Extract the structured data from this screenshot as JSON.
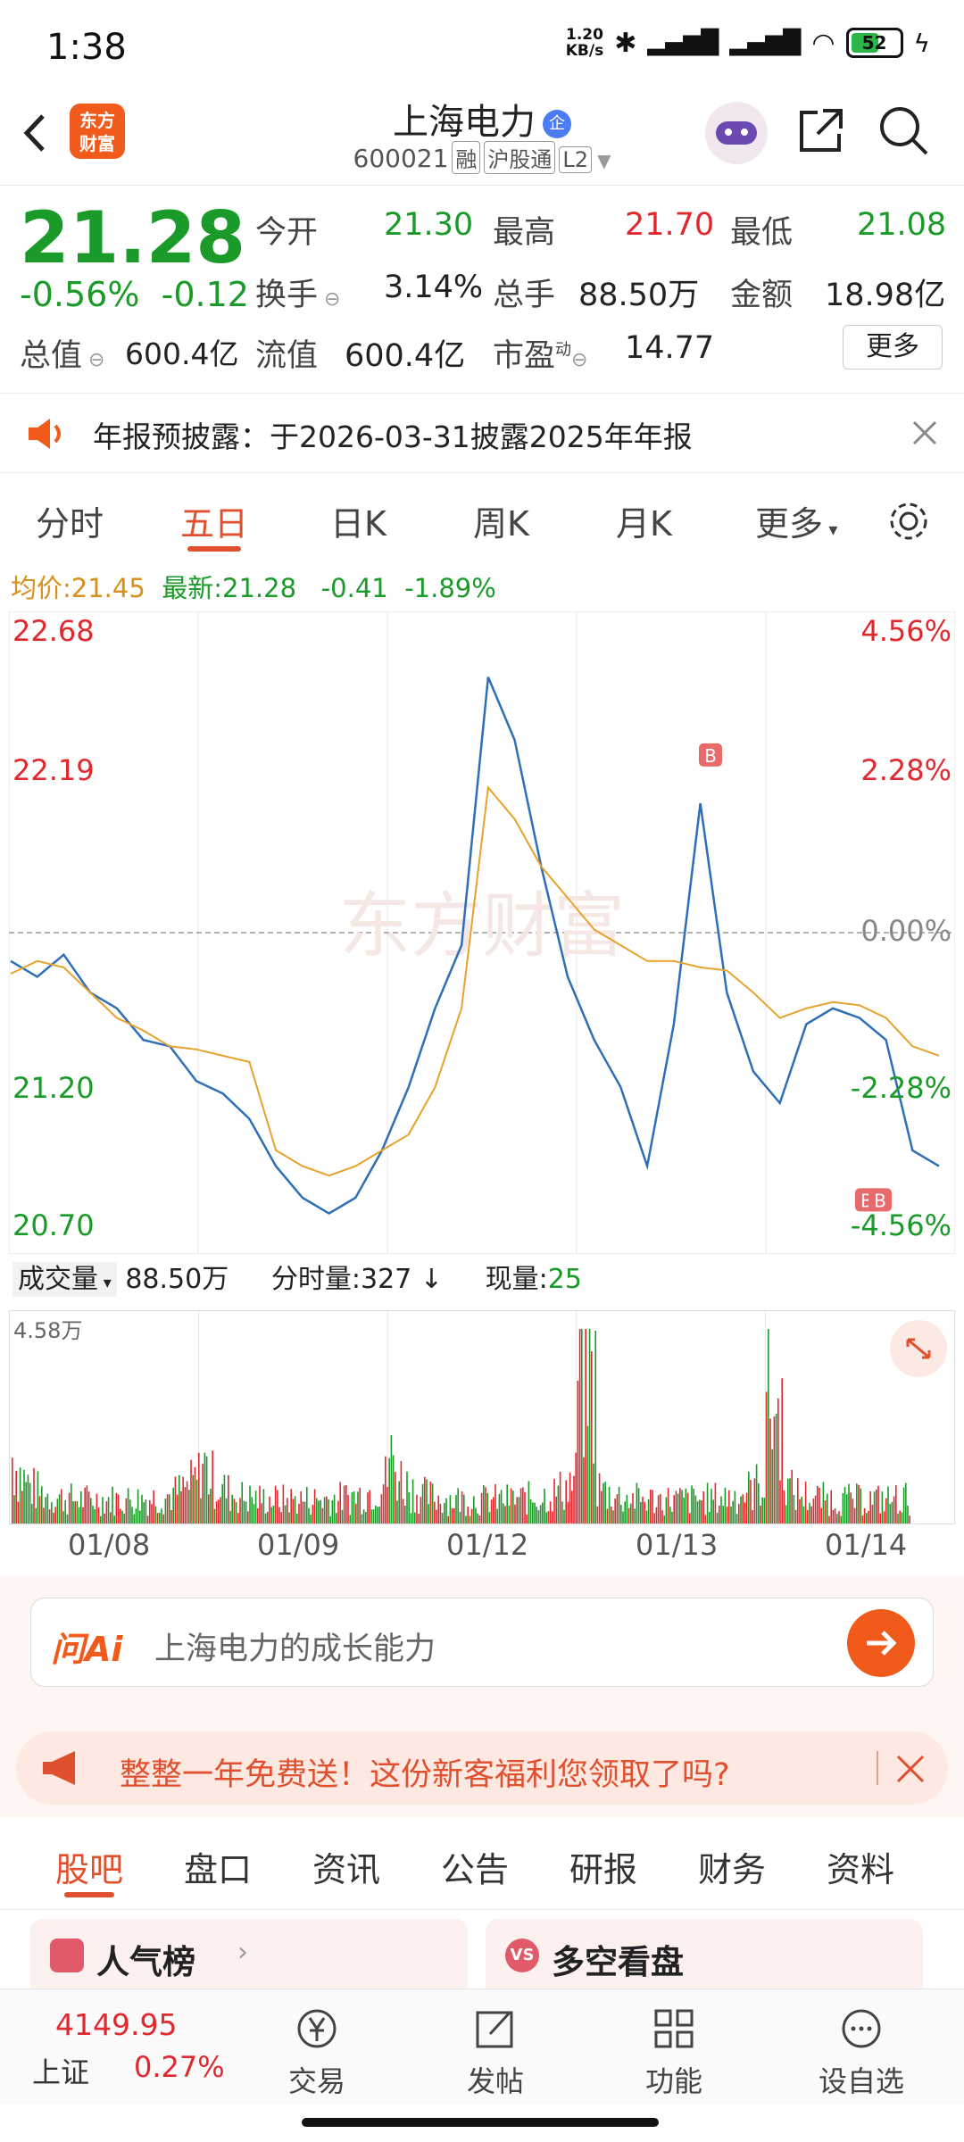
{
  "status": {
    "time": "1:38",
    "net_speed_value": "1.20",
    "net_speed_unit": "KB/s",
    "battery": "52"
  },
  "header": {
    "logo_line1": "东方",
    "logo_line2": "财富",
    "title": "上海电力",
    "badge": "企",
    "code": "600021",
    "tags": [
      "融",
      "沪股通",
      "L2"
    ]
  },
  "quote": {
    "price": "21.28",
    "change_pct": "-0.56%",
    "change": "-0.12",
    "stats": [
      {
        "label": "今开",
        "value": "21.30"
      },
      {
        "label": "最高",
        "value": "21.70"
      },
      {
        "label": "最低",
        "value": "21.08"
      },
      {
        "label": "换手",
        "value": "3.14%"
      },
      {
        "label": "总手",
        "value": "88.50万"
      },
      {
        "label": "金额",
        "value": "18.98亿"
      },
      {
        "label": "总值",
        "value": "600.4亿"
      },
      {
        "label": "流值",
        "value": "600.4亿"
      },
      {
        "label": "市盈",
        "value": "14.77"
      }
    ],
    "pe_sup": "动",
    "more_label": "更多"
  },
  "notice": {
    "text": "年报预披露：于2026-03-31披露2025年年报"
  },
  "tabs": [
    "分时",
    "五日",
    "日K",
    "周K",
    "月K",
    "更多"
  ],
  "active_tab": "五日",
  "legend": {
    "avg_label": "均价:",
    "avg_value": "21.45",
    "latest_label": "最新:",
    "latest_value": "21.28",
    "change": "-0.41",
    "change_pct": "-1.89%"
  },
  "chart_data": {
    "type": "line",
    "title": "",
    "x": [
      "01/08",
      "01/09",
      "01/12",
      "01/13",
      "01/14"
    ],
    "y_left_ticks": [
      "22.68",
      "22.19",
      "21.20",
      "20.70"
    ],
    "y_right_ticks": [
      "4.56%",
      "2.28%",
      "0.00%",
      "-2.28%",
      "-4.56%"
    ],
    "ylim": [
      20.7,
      22.68
    ],
    "prev_close": 21.69,
    "series": [
      {
        "name": "最新",
        "color": "#2e6fb7",
        "values": [
          21.6,
          21.55,
          21.62,
          21.5,
          21.45,
          21.35,
          21.33,
          21.22,
          21.18,
          21.1,
          20.95,
          20.85,
          20.8,
          20.85,
          21.0,
          21.2,
          21.45,
          21.65,
          22.5,
          22.3,
          21.9,
          21.55,
          21.35,
          21.2,
          20.95,
          21.4,
          22.1,
          21.5,
          21.25,
          21.15,
          21.4,
          21.45,
          21.42,
          21.35,
          21.0,
          20.95
        ]
      },
      {
        "name": "均价",
        "color": "#e8a22c",
        "values": [
          21.56,
          21.6,
          21.58,
          21.5,
          21.42,
          21.38,
          21.33,
          21.32,
          21.3,
          21.28,
          21.0,
          20.95,
          20.92,
          20.95,
          21.0,
          21.05,
          21.2,
          21.45,
          22.15,
          22.05,
          21.9,
          21.8,
          21.7,
          21.65,
          21.6,
          21.6,
          21.58,
          21.57,
          21.5,
          21.42,
          21.45,
          21.47,
          21.46,
          21.42,
          21.33,
          21.3
        ]
      }
    ],
    "markers": [
      "B",
      "B",
      "B"
    ],
    "volume": {
      "label": "成交量",
      "total": "88.50万",
      "per_label": "分时量:",
      "per_value": "327",
      "now_label": "现量:",
      "now_value": "25",
      "max_label": "4.58万"
    }
  },
  "watermark": "东方财富",
  "ai": {
    "logo": "问Ai",
    "placeholder": "上海电力的成长能力"
  },
  "promo": {
    "text": "整整一年免费送！这份新客福利您领取了吗?"
  },
  "tabs2": [
    "股吧",
    "盘口",
    "资讯",
    "公告",
    "研报",
    "财务",
    "资料"
  ],
  "active_tab2": "股吧",
  "cards": [
    {
      "label": "人气榜"
    },
    {
      "label": "多空看盘"
    }
  ],
  "bottom": {
    "index_value": "4149.95",
    "index_name": "上证",
    "index_change": "0.27%",
    "items": [
      "交易",
      "发帖",
      "功能",
      "设自选"
    ]
  },
  "colors": {
    "up": "#e0282e",
    "down": "#1a9a28",
    "accent": "#e0502e",
    "line": "#2e6fb7",
    "avg": "#e8a22c"
  }
}
